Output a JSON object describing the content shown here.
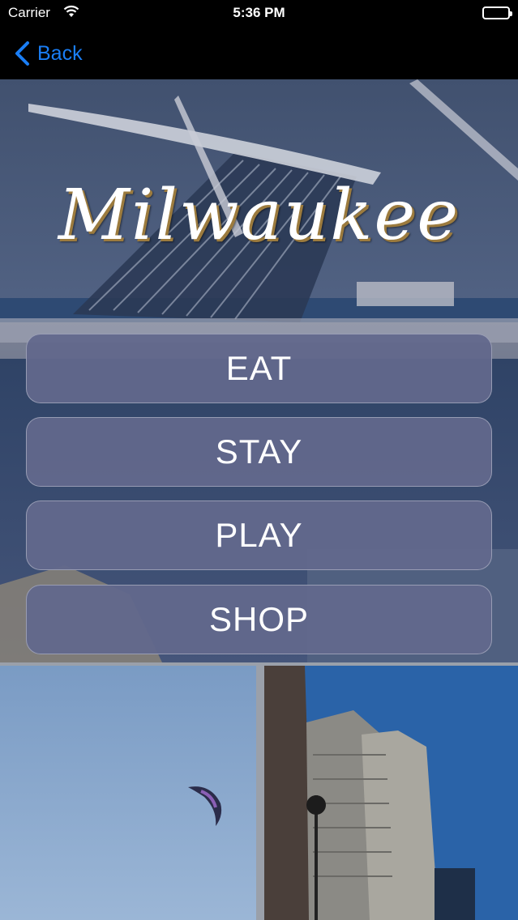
{
  "status_bar": {
    "carrier": "Carrier",
    "time": "5:36 PM"
  },
  "nav": {
    "back_label": "Back"
  },
  "hero": {
    "title": "Milwaukee"
  },
  "menu": [
    {
      "label": "EAT"
    },
    {
      "label": "STAY"
    },
    {
      "label": "PLAY"
    },
    {
      "label": "SHOP"
    }
  ],
  "colors": {
    "accent": "#1a7ef5",
    "button_bg": "#62688c",
    "nav_bg": "#000000"
  }
}
